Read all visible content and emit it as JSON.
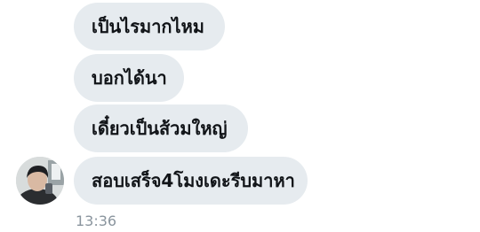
{
  "messages": [
    {
      "text": "เป็นไรมากไหม"
    },
    {
      "text": "บอกได้นา"
    },
    {
      "text": "เดี๋ยวเป็นส้วมใหญ่"
    },
    {
      "text": "สอบเสร็จ4โมงเดะรีบมาหา"
    }
  ],
  "timestamp": "13:36",
  "colors": {
    "bubble": "#e6ebef",
    "text": "#111418",
    "timestamp": "#8a959e"
  }
}
